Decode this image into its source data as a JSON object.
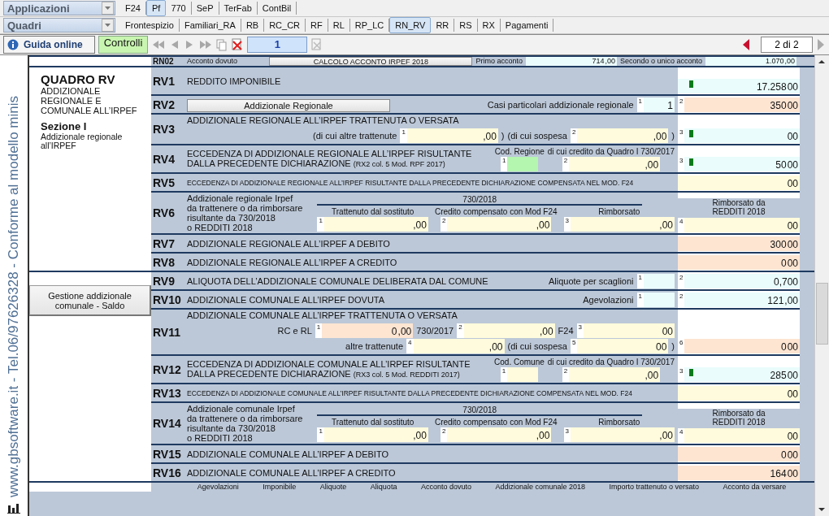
{
  "menus": [
    {
      "label": "Applicazioni"
    },
    {
      "label": "Quadri"
    }
  ],
  "app_tabs": [
    {
      "label": "F24",
      "selected": false
    },
    {
      "label": "Pf",
      "selected": true
    },
    {
      "label": "770",
      "selected": false
    },
    {
      "label": "SeP",
      "selected": false
    },
    {
      "label": "TerFab",
      "selected": false
    },
    {
      "label": "ContBil",
      "selected": false
    }
  ],
  "quadri_tabs": [
    {
      "label": "Frontespizio",
      "selected": false
    },
    {
      "label": "Familiari_RA",
      "selected": false
    },
    {
      "label": "RB",
      "selected": false
    },
    {
      "label": "RC_CR",
      "selected": false
    },
    {
      "label": "RF",
      "selected": false
    },
    {
      "label": "RL",
      "selected": false
    },
    {
      "label": "RP_LC",
      "selected": false
    },
    {
      "label": "RN_RV",
      "selected": true
    },
    {
      "label": "RR",
      "selected": false
    },
    {
      "label": "RS",
      "selected": false
    },
    {
      "label": "RX",
      "selected": false
    },
    {
      "label": "Pagamenti",
      "selected": false
    }
  ],
  "toolbar": {
    "help": "Guida online",
    "checks": "Controlli",
    "page": "1",
    "pages": "2 di 2"
  },
  "side_text": "www.gbsoftware.it - Tel.06/97626328 - Conforme al modello minis",
  "sections": [
    {
      "rows": [
        {
          "code": "RN02",
          "kind": "partial",
          "title": [
            "Acconto dovuto"
          ],
          "lines": [
            [
              {
                "kind": "button",
                "label": "CALCOLO ACCONTO IRPEF  2018"
              },
              {
                "kind": "text",
                "text": "Primo acconto"
              },
              {
                "kind": "amount",
                "value": "714",
                "cents": ",00",
                "color": "#eafcfc"
              },
              {
                "kind": "text",
                "text": "Secondo o unico acconto"
              },
              {
                "kind": "amount",
                "value": "1.070",
                "cents": ",00",
                "color": "#eafcfc"
              }
            ]
          ]
        }
      ]
    },
    {
      "panel": {
        "title": "QUADRO RV",
        "subtitle": "ADDIZIONALE REGIONALE E COMUNALE ALL’IRPEF",
        "section": "Sezione I",
        "description": "Addizionale regionale all’IRPEF"
      },
      "rows": [
        {
          "code": "RV1",
          "kind": "stack",
          "title": [
            "REDDITO IMPONIBILE"
          ],
          "total": {
            "value": "17.258",
            "cents": "00",
            "color": "#eafcfc",
            "marker": true
          }
        },
        {
          "code": "RV2",
          "kind": "side",
          "lines": [
            [
              {
                "kind": "button",
                "label": "Addizionale Regionale"
              },
              {
                "kind": "text",
                "text": "Casi particolari addizionale regionale"
              },
              {
                "kind": "code",
                "index": "1",
                "value": "1",
                "color": "#eafcfc"
              }
            ]
          ],
          "total": {
            "index": "2",
            "value": "350",
            "cents": "00",
            "color": "#fde5d2",
            "marker": false
          }
        },
        {
          "code": "RV3",
          "kind": "stack",
          "title": [
            "ADDIZIONALE REGIONALE ALL’IRPEF TRATTENUTA O VERSATA"
          ],
          "lines": [
            [
              {
                "kind": "text",
                "text": "(di cui altre trattenute"
              },
              {
                "kind": "amount",
                "index": "1",
                "cents": ",00",
                "color": "#fffbdc"
              },
              {
                "kind": "text",
                "text": ")"
              },
              {
                "kind": "text",
                "text": "(di cui sospesa"
              },
              {
                "kind": "amount",
                "index": "2",
                "cents": ",00",
                "color": "#fffbdc"
              },
              {
                "kind": "text",
                "text": ")"
              }
            ]
          ],
          "total": {
            "index": "3",
            "cents": "00",
            "color": "#eafcfc",
            "marker": true
          }
        },
        {
          "code": "RV4",
          "kind": "side",
          "title": [
            "ECCEDENZA DI ADDIZIONALE REGIONALE ALL’IRPEF RISULTANTE",
            "DALLA PRECEDENTE DICHIARAZIONE"
          ],
          "note": "(RX2 col. 5 Mod. RPF 2017)",
          "lines": [
            [
              {
                "kind": "code",
                "caption": "Cod. Regione",
                "index": "1",
                "color": "#b4f5b0"
              },
              {
                "kind": "amount",
                "caption": "di cui credito da Quadro I  730/2017",
                "index": "2",
                "cents": ",00",
                "color": "#fffbdc"
              }
            ]
          ],
          "total": {
            "index": "3",
            "value": "50",
            "cents": "00",
            "color": "#eafcfc",
            "marker": true
          }
        },
        {
          "code": "RV5",
          "kind": "note",
          "title": [
            "ECCEDENZA DI ADDIZIONALE REGIONALE  ALL’IRPEF RISULTANTE DALLA PRECEDENTE DICHIARAZIONE COMPENSATA NEL MOD. F24"
          ],
          "total": {
            "cents": "00",
            "color": "#fffbdc",
            "marker": false
          }
        },
        {
          "code": "RV6",
          "kind": "side",
          "title": [
            "Addizionale regionale Irpef",
            "da trattenere o da rimborsare",
            "risultante da 730/2018",
            "o REDDITI 2018"
          ],
          "lines": [
            [
              {
                "kind": "group",
                "caption": "730/2018",
                "items": [
                  {
                    "kind": "amount",
                    "caption": "Trattenuto dal sostituto",
                    "index": "1",
                    "cents": ",00",
                    "color": "#fffbdc"
                  },
                  {
                    "kind": "amount",
                    "caption": "Credito compensato con Mod F24",
                    "index": "2",
                    "cents": ",00",
                    "color": "#fffbdc"
                  },
                  {
                    "kind": "amount",
                    "caption": "Rimborsato",
                    "index": "3",
                    "cents": ",00",
                    "color": "#fffbdc"
                  }
                ]
              }
            ]
          ],
          "total": {
            "caption": [
              "Rimborsato da",
              "REDDITI 2018"
            ],
            "index": "4",
            "cents": "00",
            "color": "#fffbdc",
            "marker": false
          }
        },
        {
          "code": "RV7",
          "kind": "stack",
          "title": [
            "ADDIZIONALE REGIONALE ALL’IRPEF A DEBITO"
          ],
          "total": {
            "value": "300",
            "cents": "00",
            "color": "#fde5d2",
            "marker": false
          }
        },
        {
          "code": "RV8",
          "kind": "stack",
          "title": [
            "ADDIZIONALE REGIONALE ALL’IRPEF A CREDITO"
          ],
          "total": {
            "value": "0",
            "cents": "00",
            "color": "#fde5d2",
            "marker": false
          }
        }
      ]
    },
    {
      "panel": {
        "button": "Gestione addizionale comunale - Saldo"
      },
      "rows": [
        {
          "code": "RV9",
          "kind": "side",
          "title": [
            "ALIQUOTA DELL’ADDIZIONALE COMUNALE DELIBERATA DAL COMUNE"
          ],
          "lines": [
            [
              {
                "kind": "text",
                "text": "Aliquote per scaglioni"
              },
              {
                "kind": "code",
                "index": "1",
                "color": "#eafcfc"
              }
            ]
          ],
          "total": {
            "index": "2",
            "value": "0,700",
            "color": "#eafcfc",
            "marker": false
          }
        },
        {
          "code": "RV10",
          "kind": "side",
          "title": [
            "ADDIZIONALE COMUNALE ALL’IRPEF DOVUTA"
          ],
          "lines": [
            [
              {
                "kind": "text",
                "text": "Agevolazioni"
              },
              {
                "kind": "code",
                "index": "1",
                "color": "#eafcfc"
              }
            ]
          ],
          "total": {
            "index": "2",
            "value": "121",
            "cents": ",00",
            "color": "#eafcfc",
            "marker": false
          }
        },
        {
          "code": "RV11",
          "kind": "stack",
          "title": [
            "ADDIZIONALE COMUNALE ALL’IRPEF TRATTENUTA O VERSATA"
          ],
          "lines": [
            [
              {
                "kind": "text",
                "text": "RC e RL"
              },
              {
                "kind": "amount",
                "index": "1",
                "value": "0",
                "cents": ",00",
                "color": "#fde5d2"
              },
              {
                "kind": "text",
                "text": "730/2017"
              },
              {
                "kind": "amount",
                "index": "2",
                "cents": ",00",
                "color": "#fffbdc"
              },
              {
                "kind": "text",
                "text": "F24"
              },
              {
                "kind": "amount",
                "index": "3",
                "cents": "00",
                "color": "#fffbdc"
              }
            ],
            [
              {
                "kind": "text",
                "text": "altre trattenute"
              },
              {
                "kind": "amount",
                "index": "4",
                "cents": ",00",
                "color": "#fffbdc"
              },
              {
                "kind": "text",
                "text": "(di cui sospesa"
              },
              {
                "kind": "amount",
                "index": "5",
                "cents": "00",
                "color": "#fffbdc"
              },
              {
                "kind": "text",
                "text": ")"
              }
            ]
          ],
          "total": {
            "index": "6",
            "value": "0",
            "cents": "00",
            "color": "#fde5d2",
            "marker": false
          }
        },
        {
          "code": "RV12",
          "kind": "side",
          "title": [
            "ECCEDENZA DI ADDIZIONALE COMUNALE ALL’IRPEF RISULTANTE",
            "DALLA PRECEDENTE DICHIARAZIONE"
          ],
          "note": "(RX3 col. 5 Mod. REDDITI 2017)",
          "lines": [
            [
              {
                "kind": "code",
                "caption": "Cod. Comune",
                "index": "1",
                "color": "#fffbdc"
              },
              {
                "kind": "amount",
                "caption": "di cui credito da Quadro I  730/2017",
                "index": "2",
                "cents": ",00",
                "color": "#fffbdc"
              }
            ]
          ],
          "total": {
            "index": "3",
            "value": "285",
            "cents": "00",
            "color": "#eafcfc",
            "marker": true
          }
        },
        {
          "code": "RV13",
          "kind": "note",
          "title": [
            "ECCEDENZA DI ADDIZIONALE COMUNALE ALL’IRPEF RISULTANTE DALLA PRECEDENTE DICHIARAZIONE COMPENSATA NEL MOD. F24"
          ],
          "total": {
            "cents": "00",
            "color": "#fffbdc",
            "marker": false
          }
        },
        {
          "code": "RV14",
          "kind": "side",
          "title": [
            "Addizionale comunale Irpef",
            "da trattenere o da rimborsare",
            "risultante da 730/2018",
            "o REDDITI 2018"
          ],
          "lines": [
            [
              {
                "kind": "group",
                "caption": "730/2018",
                "items": [
                  {
                    "kind": "amount",
                    "caption": "Trattenuto dal sostituto",
                    "index": "1",
                    "cents": ",00",
                    "color": "#fffbdc"
                  },
                  {
                    "kind": "amount",
                    "caption": "Credito compensato con Mod F24",
                    "index": "2",
                    "cents": ",00",
                    "color": "#fffbdc"
                  },
                  {
                    "kind": "amount",
                    "caption": "Rimborsato",
                    "index": "3",
                    "cents": ",00",
                    "color": "#fffbdc"
                  }
                ]
              }
            ]
          ],
          "total": {
            "caption": [
              "Rimborsato da",
              "REDDITI 2018"
            ],
            "index": "4",
            "cents": "00",
            "color": "#fffbdc",
            "marker": false
          }
        },
        {
          "code": "RV15",
          "kind": "stack",
          "title": [
            "ADDIZIONALE COMUNALE ALL’IRPEF A DEBITO"
          ],
          "total": {
            "value": "0",
            "cents": "00",
            "color": "#fde5d2",
            "marker": false
          }
        },
        {
          "code": "RV16",
          "kind": "stack",
          "title": [
            "ADDIZIONALE COMUNALE ALL’IRPEF A CREDITO"
          ],
          "total": {
            "value": "164",
            "cents": "00",
            "color": "#fde5d2",
            "marker": false
          }
        }
      ]
    },
    {
      "rows": [
        {
          "kind": "partial",
          "lines": [
            [
              {
                "kind": "text",
                "text": "Agevolazioni"
              },
              {
                "kind": "text",
                "text": "Imponibile"
              },
              {
                "kind": "text",
                "text": "Aliquote"
              },
              {
                "kind": "text",
                "text": "Aliquota"
              },
              {
                "kind": "text",
                "text": "Acconto dovuto"
              },
              {
                "kind": "text",
                "text": "Addizionale comunale 2018"
              },
              {
                "kind": "text",
                "text": "Importo trattenuto o versato"
              },
              {
                "kind": "text",
                "text": "Acconto da versare"
              }
            ]
          ]
        }
      ]
    }
  ]
}
